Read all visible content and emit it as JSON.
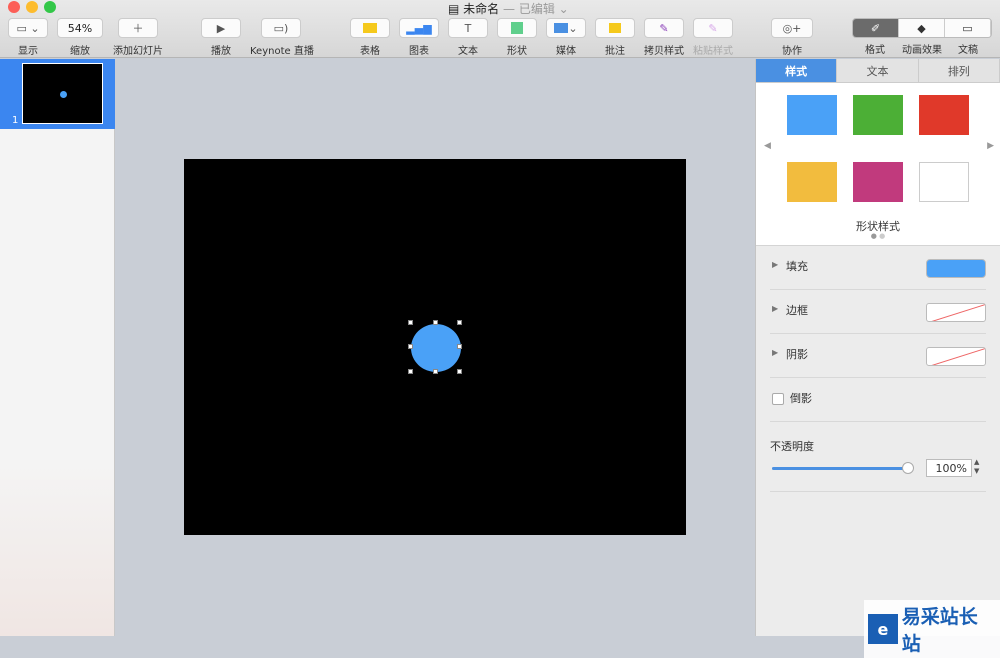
{
  "window": {
    "title": "未命名",
    "status": "— 已编辑 ⌄"
  },
  "toolbar": {
    "view": "显示",
    "zoom_value": "54%",
    "zoom": "缩放",
    "add_slide": "添加幻灯片",
    "play": "播放",
    "keynote_live": "Keynote 直播",
    "table": "表格",
    "chart": "图表",
    "text": "文本",
    "shape": "形状",
    "media": "媒体",
    "comment": "批注",
    "copy_style": "拷贝样式",
    "paste_style": "粘贴样式",
    "collaborate": "协作",
    "format": "格式",
    "animate": "动画效果",
    "document": "文稿"
  },
  "navigator": {
    "slides": [
      {
        "number": "1"
      }
    ]
  },
  "inspector": {
    "tabs": [
      "样式",
      "文本",
      "排列"
    ],
    "swatches": [
      "#4aa1f7",
      "#4caf36",
      "#e0392a",
      "#f2bc3e",
      "#c13a7d",
      "#ffffff"
    ],
    "style_label": "形状样式",
    "fill": {
      "label": "填充",
      "color": "#4aa1f7"
    },
    "border": {
      "label": "边框"
    },
    "shadow": {
      "label": "阴影"
    },
    "reflection": {
      "label": "倒影",
      "checked": false
    },
    "opacity": {
      "label": "不透明度",
      "value": "100%",
      "percent": 100
    }
  },
  "watermark": {
    "text": "易采站长站"
  }
}
